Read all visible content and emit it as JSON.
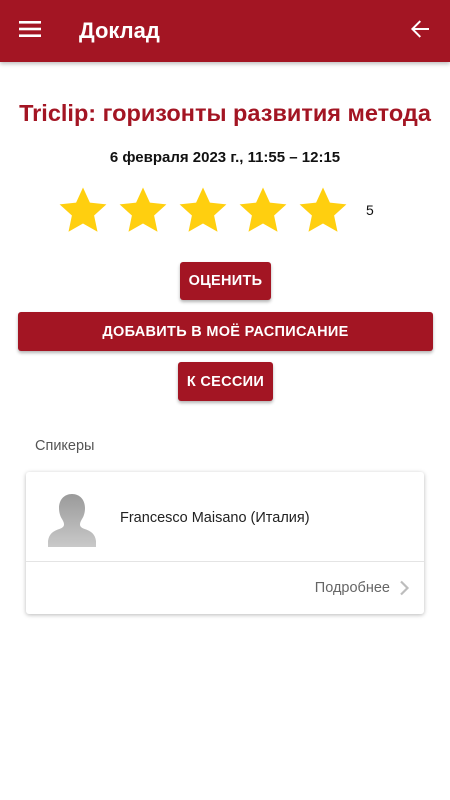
{
  "header": {
    "title": "Доклад",
    "menu_icon": "menu-icon",
    "back_icon": "arrow-back-icon"
  },
  "talk": {
    "title": "Triclip: горизонты развития метода",
    "datetime": "6 февраля 2023 г., 11:55 – 12:15",
    "rating": {
      "stars_total": 5,
      "stars_filled": 5,
      "value": "5"
    }
  },
  "actions": {
    "rate_label": "ОЦЕНИТЬ",
    "add_to_schedule_label": "ДОБАВИТЬ В МОЁ РАСПИСАНИЕ",
    "to_session_label": "К СЕССИИ"
  },
  "speakers": {
    "section_label": "Спикеры",
    "items": [
      {
        "name": "Francesco Maisano (Италия)",
        "details_label": "Подробнее"
      }
    ]
  },
  "colors": {
    "primary": "#a31523",
    "star": "#ffcf0f",
    "background": "#ffffff"
  }
}
